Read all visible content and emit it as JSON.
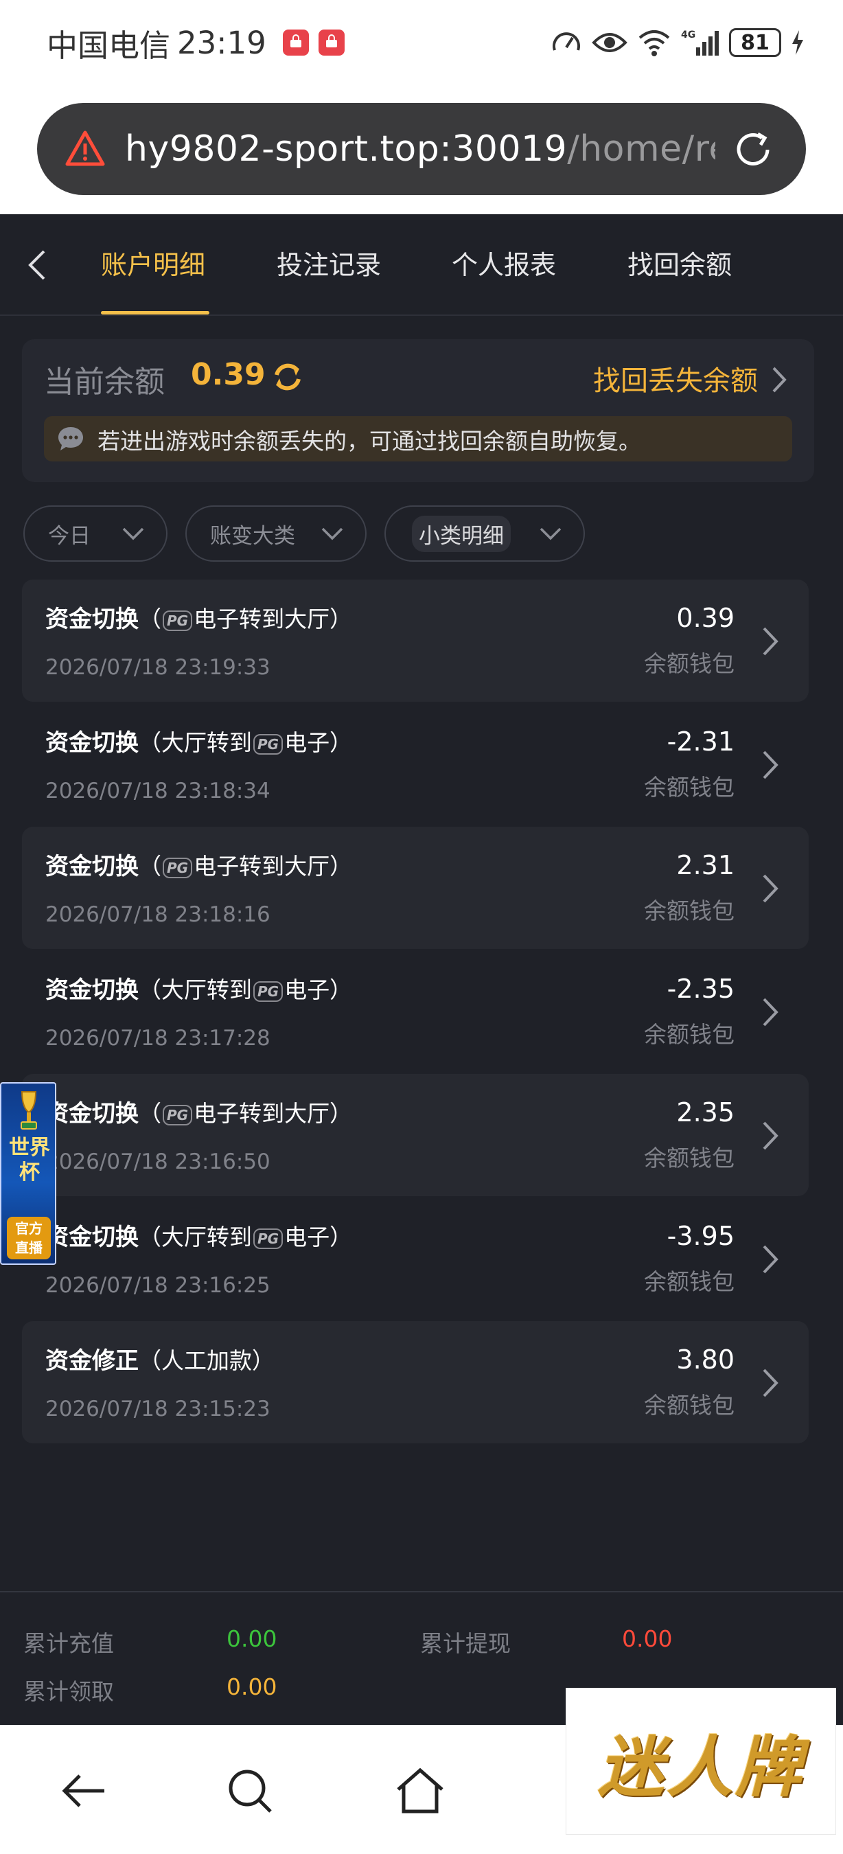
{
  "status_bar": {
    "carrier": "中国电信",
    "time": "23:19",
    "battery": "81",
    "network": "4G"
  },
  "url_bar": {
    "host": "hy9802-sport.top:30019",
    "path": "/home/re"
  },
  "tabs": [
    {
      "label": "账户明细",
      "active": true
    },
    {
      "label": "投注记录",
      "active": false
    },
    {
      "label": "个人报表",
      "active": false
    },
    {
      "label": "找回余额",
      "active": false
    }
  ],
  "balance": {
    "label": "当前余额",
    "value": "0.39",
    "recover_label": "找回丢失余额",
    "tip": "若进出游戏时余额丢失的，可通过找回余额自助恢复。"
  },
  "filters": [
    {
      "label": "今日"
    },
    {
      "label": "账变大类"
    },
    {
      "label": "小类明细"
    }
  ],
  "transactions": [
    {
      "type": "资金切换",
      "detail_pre": "（",
      "pg": "PG",
      "detail": "电子转到大厅）",
      "date": "2026/07/18 23:19:33",
      "amount": "0.39",
      "wallet": "余额钱包"
    },
    {
      "type": "资金切换",
      "detail_pre": "（大厅转到",
      "pg": "PG",
      "detail": "电子）",
      "date": "2026/07/18 23:18:34",
      "amount": "-2.31",
      "wallet": "余额钱包"
    },
    {
      "type": "资金切换",
      "detail_pre": "（",
      "pg": "PG",
      "detail": "电子转到大厅）",
      "date": "2026/07/18 23:18:16",
      "amount": "2.31",
      "wallet": "余额钱包"
    },
    {
      "type": "资金切换",
      "detail_pre": "（大厅转到",
      "pg": "PG",
      "detail": "电子）",
      "date": "2026/07/18 23:17:28",
      "amount": "-2.35",
      "wallet": "余额钱包"
    },
    {
      "type": "资金切换",
      "detail_pre": "（",
      "pg": "PG",
      "detail": "电子转到大厅）",
      "date": "2026/07/18 23:16:50",
      "amount": "2.35",
      "wallet": "余额钱包"
    },
    {
      "type": "资金切换",
      "detail_pre": "（大厅转到",
      "pg": "PG",
      "detail": "电子）",
      "date": "2026/07/18 23:16:25",
      "amount": "-3.95",
      "wallet": "余额钱包"
    },
    {
      "type": "资金修正",
      "detail_pre": "（人工加款）",
      "pg": "",
      "detail": "",
      "date": "2026/07/18 23:15:23",
      "amount": "3.80",
      "wallet": "余额钱包"
    }
  ],
  "summary": {
    "deposit_label": "累计充值",
    "deposit_value": "0.00",
    "withdraw_label": "累计提现",
    "withdraw_value": "0.00",
    "claim_label": "累计领取",
    "claim_value": "0.00"
  },
  "world_cup_badge": {
    "title": "世界杯",
    "sub_line1": "官方",
    "sub_line2": "直播"
  },
  "watermark": "迷人牌",
  "colors": {
    "accent": "#f4b43a",
    "background": "#1f2128",
    "green": "#3cc43c",
    "red": "#ff4a3a"
  }
}
